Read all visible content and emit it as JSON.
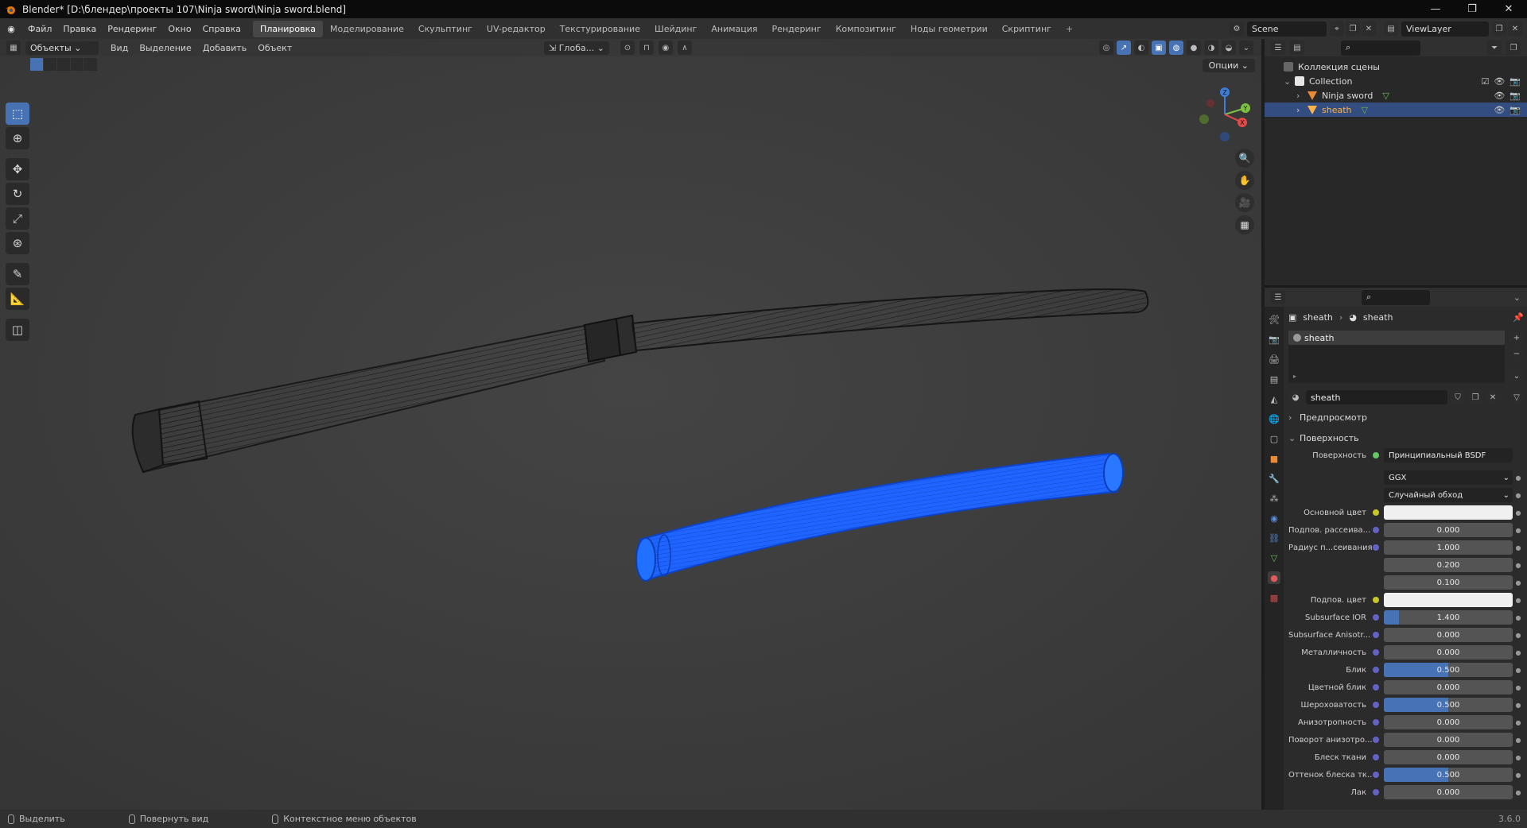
{
  "window": {
    "title": "Blender* [D:\\блендер\\проекты 107\\Ninja sword\\Ninja sword.blend]",
    "controls": [
      "minimize-icon",
      "restore-icon",
      "close-icon"
    ]
  },
  "menu": [
    "Файл",
    "Правка",
    "Рендеринг",
    "Окно",
    "Справка"
  ],
  "workspaces": [
    "Планировка",
    "Моделирование",
    "Скульптинг",
    "UV-редактор",
    "Текстурирование",
    "Шейдинг",
    "Анимация",
    "Рендеринг",
    "Композитинг",
    "Ноды геометрии",
    "Скриптинг"
  ],
  "active_workspace": "Планировка",
  "scene": {
    "name": "Scene",
    "view_layer": "ViewLayer"
  },
  "viewport": {
    "mode": "Объекты",
    "menus": [
      "Вид",
      "Выделение",
      "Добавить",
      "Объект"
    ],
    "orientation": "Глоба...",
    "options_label": "Опции",
    "selection_color": "#1f6cff",
    "wire_color": "#1a1a1a",
    "gizmo": {
      "x": "X",
      "y": "Y",
      "z": "Z",
      "x_color": "#e34a4a",
      "y_color": "#7bc142",
      "z_color": "#3d7dd8"
    }
  },
  "outliner": {
    "root": "Коллекция сцены",
    "collection": "Collection",
    "objects": [
      {
        "name": "Ninja sword",
        "selected": false
      },
      {
        "name": "sheath",
        "selected": true
      }
    ]
  },
  "properties": {
    "breadcrumb": [
      "sheath",
      "sheath"
    ],
    "slot": "sheath",
    "material_name": "sheath",
    "sections": {
      "preview": "Предпросмотр",
      "surface": "Поверхность"
    },
    "surface_label": "Поверхность",
    "surface_value": "Принципиальный BSDF",
    "distribution": "GGX",
    "subsurface_method": "Случайный обход",
    "fields": [
      {
        "label": "Основной цвет",
        "value": "",
        "type": "color",
        "color": "#f0f0f0",
        "sock": "y"
      },
      {
        "label": "Подпов. рассеива...",
        "value": "0.000",
        "fill": 0,
        "sock": "b"
      },
      {
        "label": "Радиус п...сеивания",
        "value": "1.000",
        "fill": 0,
        "sock": "b"
      },
      {
        "label": "",
        "value": "0.200",
        "fill": 0,
        "sock": "none"
      },
      {
        "label": "",
        "value": "0.100",
        "fill": 0,
        "sock": "none"
      },
      {
        "label": "Подпов. цвет",
        "value": "",
        "type": "color",
        "color": "#f0f0f0",
        "sock": "y"
      },
      {
        "label": "Subsurface IOR",
        "value": "1.400",
        "fill": 0.12,
        "sock": "b"
      },
      {
        "label": "Subsurface Anisotr...",
        "value": "0.000",
        "fill": 0,
        "sock": "b"
      },
      {
        "label": "Металличность",
        "value": "0.000",
        "fill": 0,
        "sock": "b"
      },
      {
        "label": "Блик",
        "value": "0.500",
        "fill": 0.5,
        "sock": "b"
      },
      {
        "label": "Цветной блик",
        "value": "0.000",
        "fill": 0,
        "sock": "b"
      },
      {
        "label": "Шероховатость",
        "value": "0.500",
        "fill": 0.5,
        "sock": "b"
      },
      {
        "label": "Анизотропность",
        "value": "0.000",
        "fill": 0,
        "sock": "b"
      },
      {
        "label": "Поворот анизотро...",
        "value": "0.000",
        "fill": 0,
        "sock": "b"
      },
      {
        "label": "Блеск ткани",
        "value": "0.000",
        "fill": 0,
        "sock": "b"
      },
      {
        "label": "Оттенок блеска тк...",
        "value": "0.500",
        "fill": 0.5,
        "sock": "b"
      },
      {
        "label": "Лак",
        "value": "0.000",
        "fill": 0,
        "sock": "b"
      }
    ]
  },
  "status": {
    "select": "Выделить",
    "rotate": "Повернуть вид",
    "context": "Контекстное меню объектов",
    "version": "3.6.0"
  }
}
